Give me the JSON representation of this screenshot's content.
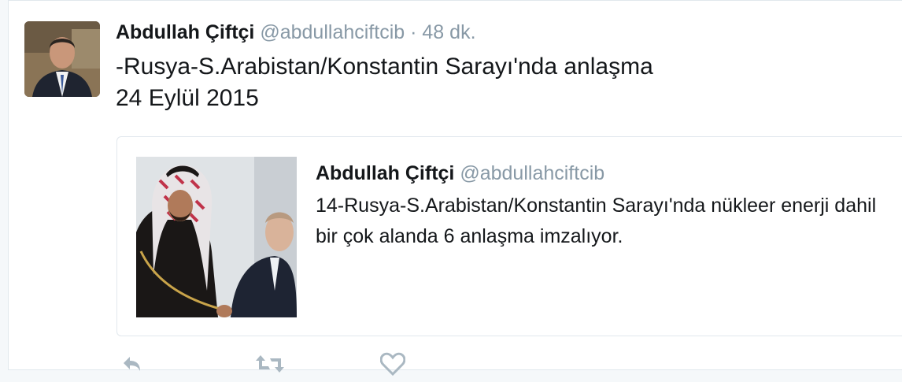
{
  "tweet": {
    "display_name": "Abdullah Çiftçi",
    "screen_name": "@abdullahciftcib",
    "separator": "·",
    "time": "48 dk.",
    "text_lines": [
      "-Rusya-S.Arabistan/Konstantin Sarayı'nda anlaşma",
      "24 Eylül 2015"
    ]
  },
  "quoted_tweet": {
    "display_name": "Abdullah Çiftçi",
    "screen_name": "@abdullahciftcib",
    "text": "14-Rusya-S.Arabistan/Konstantin Sarayı'nda nükleer enerji dahil bir çok alanda 6 anlaşma imzalıyor."
  },
  "actions": {
    "reply_icon": "reply-icon",
    "retweet_icon": "retweet-icon",
    "like_icon": "heart-icon"
  },
  "colors": {
    "name": "#14171a",
    "secondary": "#8899a6",
    "border": "#e1e8ed",
    "action_icon": "#aab8c2"
  }
}
